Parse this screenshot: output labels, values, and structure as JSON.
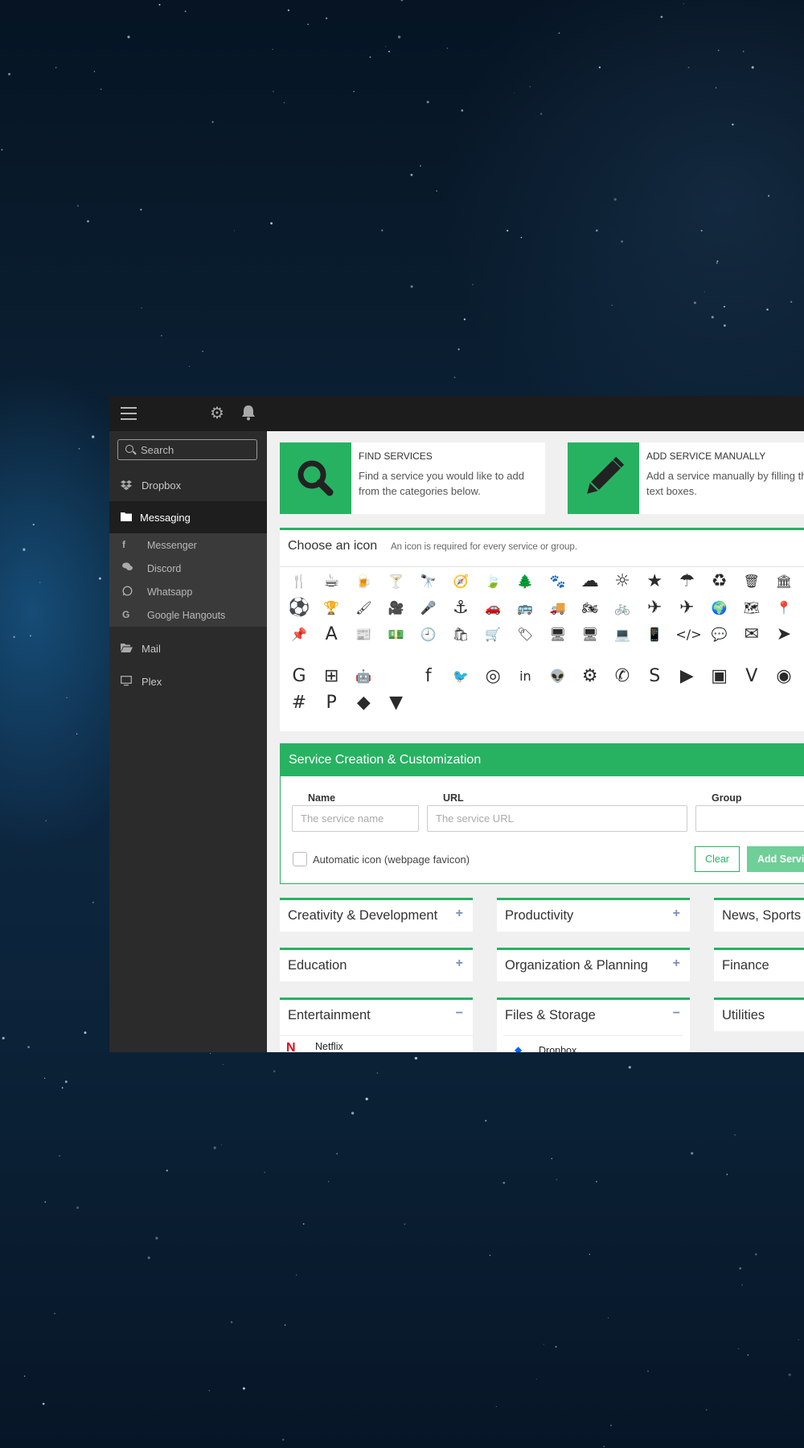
{
  "topbar": {
    "menu_icon": "hamburger-icon",
    "settings_icon": "gear-icon",
    "notifications_icon": "bell-icon"
  },
  "sidebar": {
    "search_placeholder": "Search",
    "items": [
      {
        "label": "Dropbox",
        "icon": "dropbox-icon"
      },
      {
        "label": "Messaging",
        "icon": "folder-icon",
        "active": true
      },
      {
        "label": "Mail",
        "icon": "folder-open-icon"
      },
      {
        "label": "Plex",
        "icon": "monitor-icon"
      }
    ],
    "subitems": [
      {
        "label": "Messenger",
        "icon": "facebook-icon"
      },
      {
        "label": "Discord",
        "icon": "chat-icon"
      },
      {
        "label": "Whatsapp",
        "icon": "whatsapp-icon"
      },
      {
        "label": "Google Hangouts",
        "icon": "google-icon"
      }
    ]
  },
  "find_services": {
    "title": "FIND SERVICES",
    "description": "Find a service you would like to add from the categories below.",
    "icon": "search-icon"
  },
  "add_manually": {
    "title": "ADD SERVICE MANUALLY",
    "description": "Add a service manually by filling the text boxes.",
    "icon": "pencil-icon"
  },
  "icon_chooser": {
    "title": "Choose an icon",
    "subtitle": "An icon is required for every service or group."
  },
  "creation": {
    "title": "Service Creation & Customization",
    "name_label": "Name",
    "name_placeholder": "The service name",
    "url_label": "URL",
    "url_placeholder": "The service URL",
    "group_label": "Group",
    "auto_icon_label": "Automatic icon (webpage favicon)",
    "clear_label": "Clear",
    "add_label": "Add Servic"
  },
  "categories": [
    {
      "label": "Creativity & Development",
      "toggle": "+"
    },
    {
      "label": "Productivity",
      "toggle": "+"
    },
    {
      "label": "News, Sports &",
      "toggle": ""
    },
    {
      "label": "Education",
      "toggle": "+"
    },
    {
      "label": "Organization & Planning",
      "toggle": "+"
    },
    {
      "label": "Finance",
      "toggle": ""
    },
    {
      "label": "Entertainment",
      "toggle": "−",
      "item": "Netflix"
    },
    {
      "label": "Files & Storage",
      "toggle": "−",
      "item": "Dropbox"
    },
    {
      "label": "Utilities",
      "toggle": ""
    }
  ],
  "colors": {
    "accent": "#27b262",
    "sidebar_bg": "#2b2b2b",
    "topbar_bg": "#1c1c1c"
  }
}
